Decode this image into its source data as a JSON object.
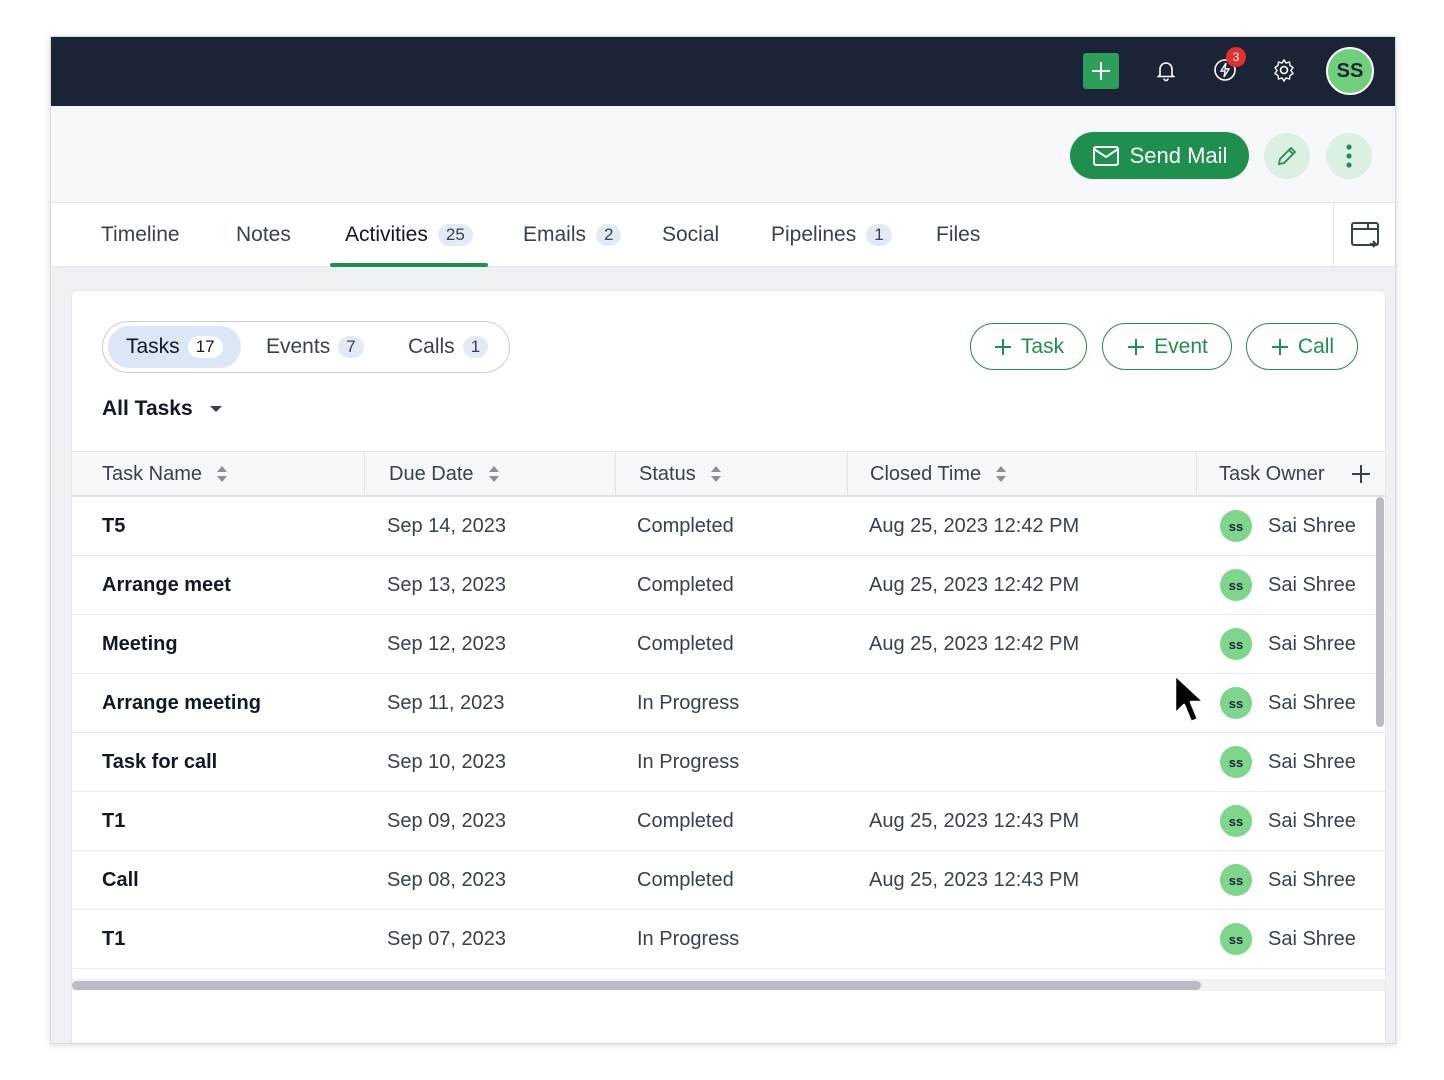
{
  "topbar": {
    "notification_count": "3",
    "user_initials": "SS"
  },
  "header": {
    "send_mail_label": "Send Mail"
  },
  "tabs": [
    {
      "label": "Timeline",
      "count": ""
    },
    {
      "label": "Notes",
      "count": ""
    },
    {
      "label": "Activities",
      "count": "25"
    },
    {
      "label": "Emails",
      "count": "2"
    },
    {
      "label": "Social",
      "count": ""
    },
    {
      "label": "Pipelines",
      "count": "1"
    },
    {
      "label": "Files",
      "count": ""
    }
  ],
  "activities": {
    "segments": [
      {
        "label": "Tasks",
        "count": "17"
      },
      {
        "label": "Events",
        "count": "7"
      },
      {
        "label": "Calls",
        "count": "1"
      }
    ],
    "add_buttons": [
      "Task",
      "Event",
      "Call"
    ],
    "filter_label": "All Tasks"
  },
  "table": {
    "columns": [
      "Task Name",
      "Due Date",
      "Status",
      "Closed Time",
      "Task Owner"
    ],
    "rows": [
      {
        "name": "T5",
        "due": "Sep 14, 2023",
        "status": "Completed",
        "closed": "Aug 25, 2023 12:42 PM",
        "owner": "Sai Shree",
        "initials": "ss"
      },
      {
        "name": "Arrange meet",
        "due": "Sep 13, 2023",
        "status": "Completed",
        "closed": "Aug 25, 2023 12:42 PM",
        "owner": "Sai Shree",
        "initials": "ss"
      },
      {
        "name": "Meeting",
        "due": "Sep 12, 2023",
        "status": "Completed",
        "closed": "Aug 25, 2023 12:42 PM",
        "owner": "Sai Shree",
        "initials": "ss"
      },
      {
        "name": "Arrange meeting",
        "due": "Sep 11, 2023",
        "status": "In Progress",
        "closed": "",
        "owner": "Sai Shree",
        "initials": "ss"
      },
      {
        "name": "Task for call",
        "due": "Sep 10, 2023",
        "status": "In Progress",
        "closed": "",
        "owner": "Sai Shree",
        "initials": "ss"
      },
      {
        "name": "T1",
        "due": "Sep 09, 2023",
        "status": "Completed",
        "closed": "Aug 25, 2023 12:43 PM",
        "owner": "Sai Shree",
        "initials": "ss"
      },
      {
        "name": "Call",
        "due": "Sep 08, 2023",
        "status": "Completed",
        "closed": "Aug 25, 2023 12:43 PM",
        "owner": "Sai Shree",
        "initials": "ss"
      },
      {
        "name": "T1",
        "due": "Sep 07, 2023",
        "status": "In Progress",
        "closed": "",
        "owner": "Sai Shree",
        "initials": "ss"
      }
    ]
  },
  "colors": {
    "accent": "#1f8f4e",
    "topbar": "#1b2337",
    "avatar": "#7ed58c",
    "badge": "#e0312e"
  },
  "icons": [
    "plus-icon",
    "bell-icon",
    "flash-icon",
    "gear-icon",
    "mail-icon",
    "pencil-icon",
    "more-vertical-icon",
    "panel-icon",
    "chevron-down-icon",
    "sort-icon",
    "add-column-icon"
  ]
}
